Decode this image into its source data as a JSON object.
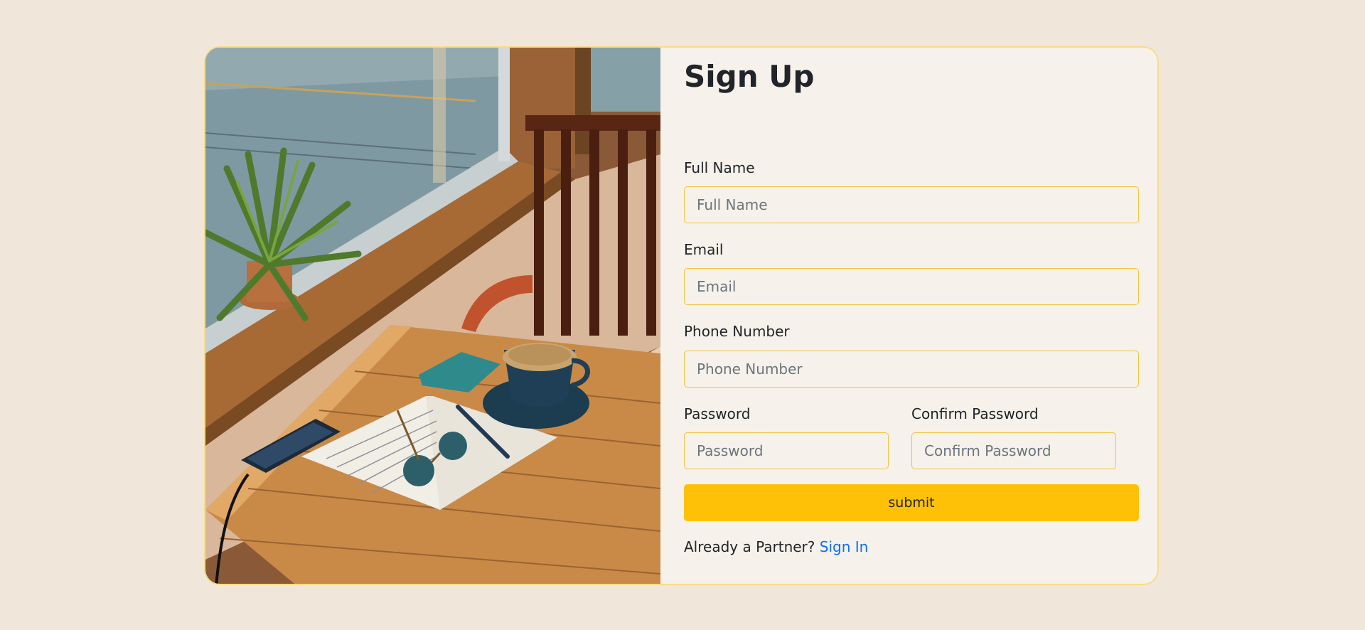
{
  "form": {
    "title": "Sign Up",
    "full_name": {
      "label": "Full Name",
      "placeholder": "Full Name",
      "value": ""
    },
    "email": {
      "label": "Email",
      "placeholder": "Email",
      "value": ""
    },
    "phone": {
      "label": "Phone Number",
      "placeholder": "Phone Number",
      "value": ""
    },
    "password": {
      "label": "Password",
      "placeholder": "Password",
      "value": ""
    },
    "confirm_password": {
      "label": "Confirm Password",
      "placeholder": "Confirm Password",
      "value": ""
    },
    "submit_label": "submit",
    "signin_prompt": "Already a Partner?",
    "signin_link": "Sign In"
  },
  "colors": {
    "page_background": "#f0e7da",
    "card_background": "#f6f1ea",
    "card_border": "#f6dc8e",
    "input_border": "#f2c43d",
    "submit_background": "#ffc107",
    "link": "#0d6efd"
  },
  "image": {
    "subject": "cafe-table-by-window"
  }
}
